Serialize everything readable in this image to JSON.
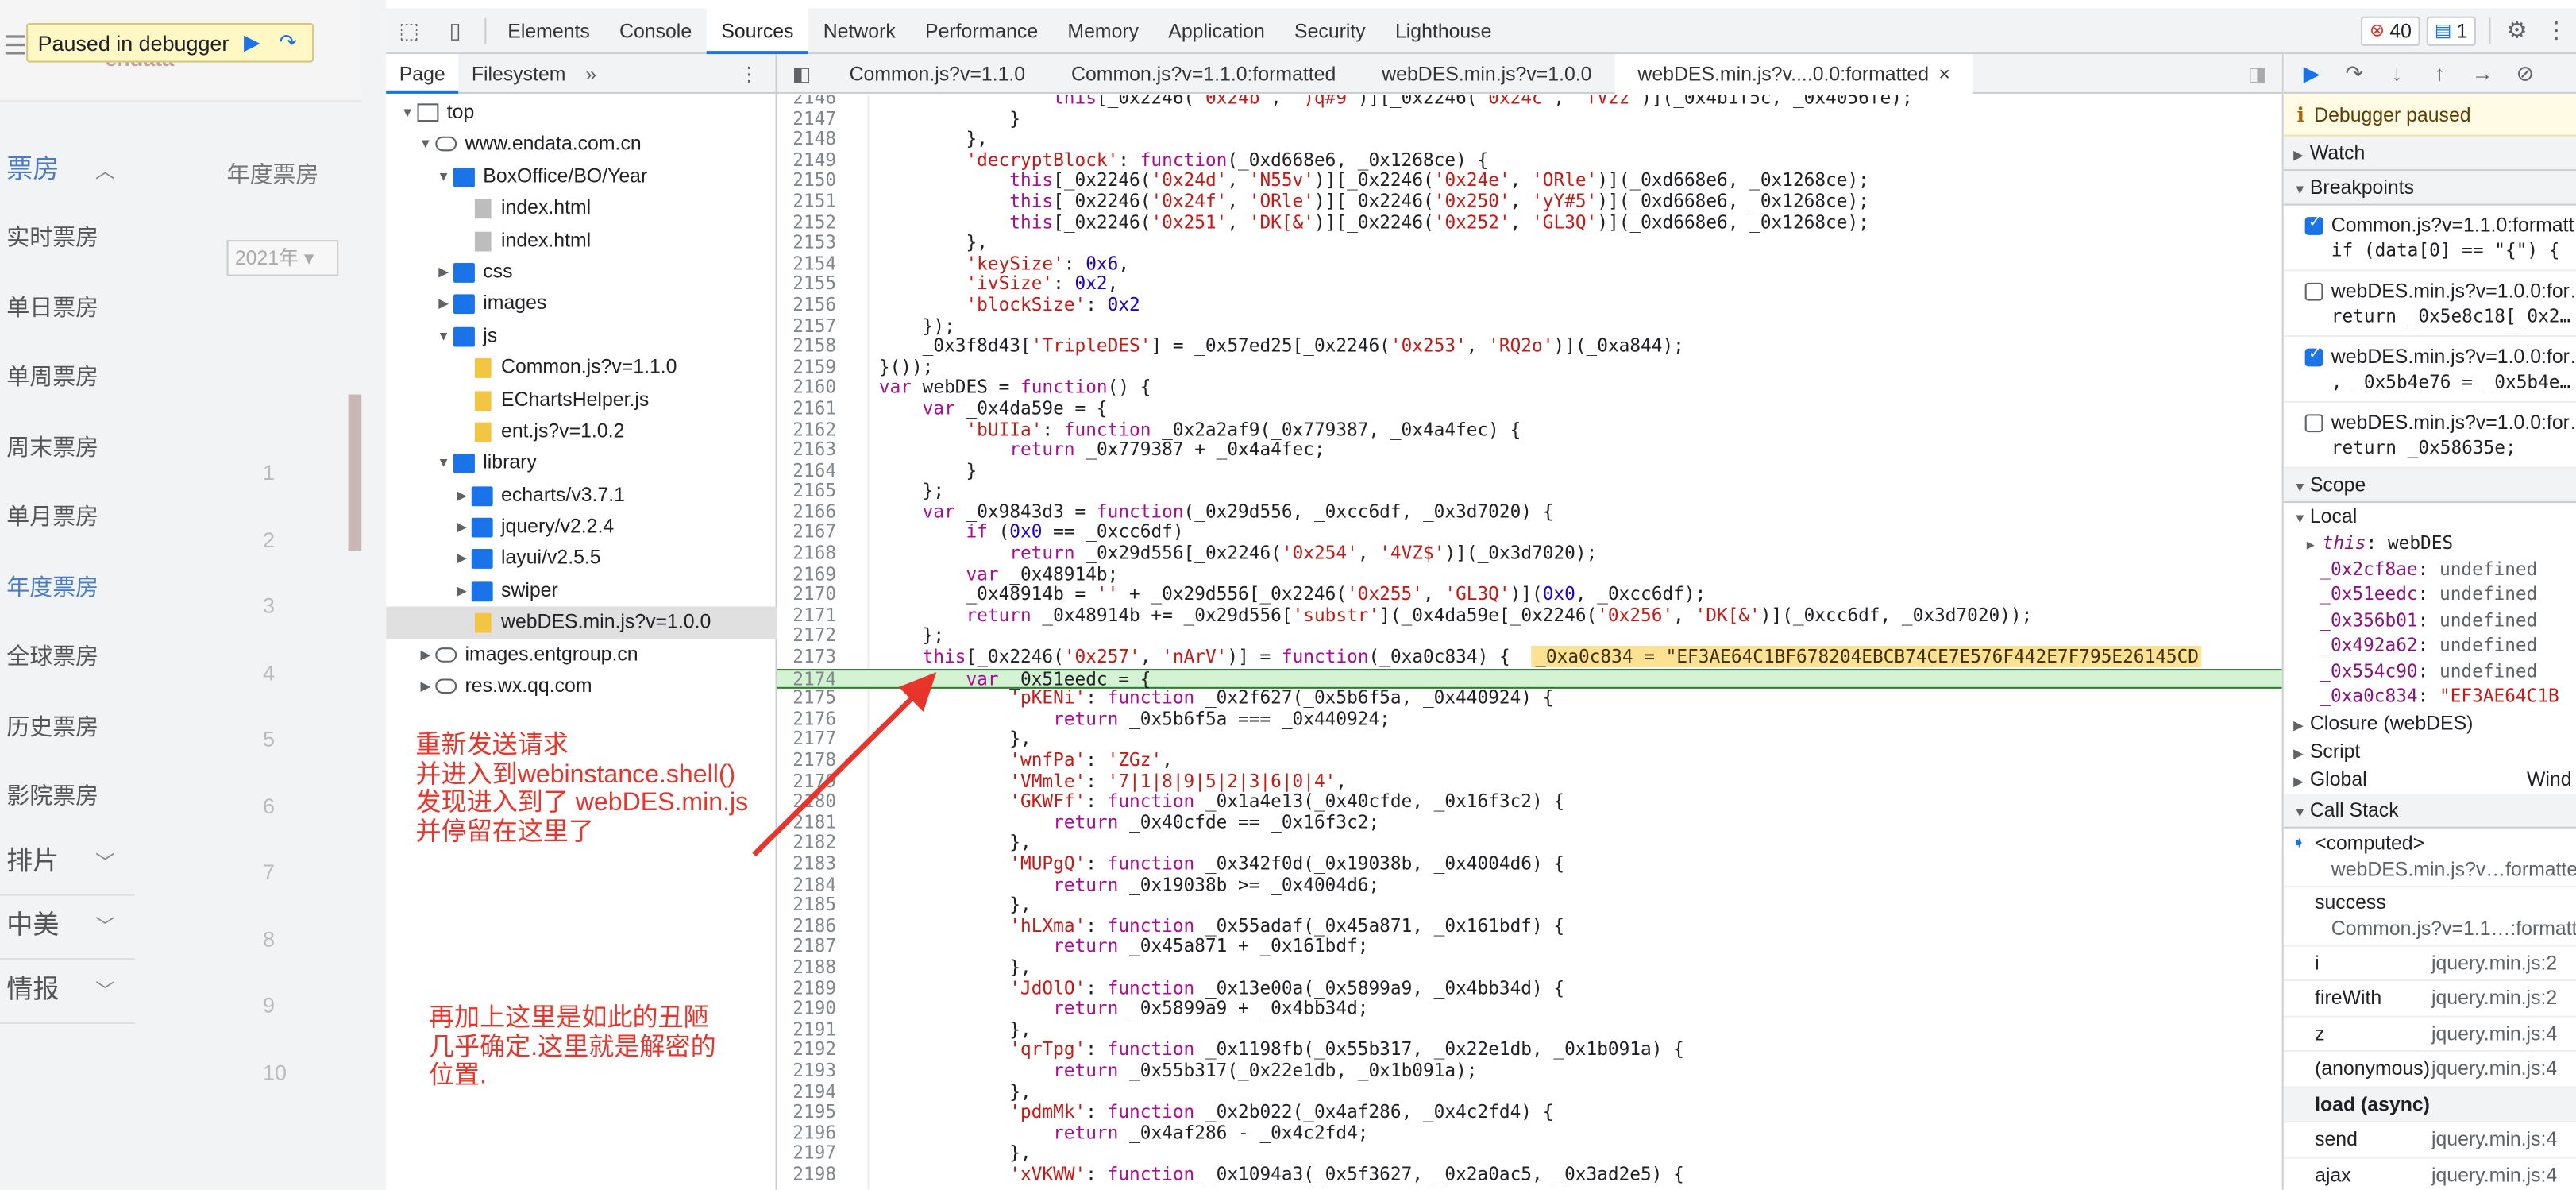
{
  "site": {
    "logo": "endata",
    "paused_label": "Paused in debugger",
    "year_title": "年度票房",
    "year_select": "2021年",
    "nav_head": "票房",
    "nav_items": [
      "实时票房",
      "单日票房",
      "单周票房",
      "周末票房",
      "单月票房",
      "年度票房",
      "全球票房",
      "历史票房",
      "影院票房"
    ],
    "nav_groups": [
      "排片",
      "中美",
      "情报"
    ],
    "ranks": [
      "1",
      "2",
      "3",
      "4",
      "5",
      "6",
      "7",
      "8",
      "9",
      "10"
    ]
  },
  "devtools": {
    "tabs": [
      "Elements",
      "Console",
      "Sources",
      "Network",
      "Performance",
      "Memory",
      "Application",
      "Security",
      "Lighthouse"
    ],
    "active_tab": "Sources",
    "error_count": "40",
    "message_count": "1",
    "navigator_tabs": [
      "Page",
      "Filesystem"
    ],
    "tree": [
      {
        "label": "top",
        "depth": 0,
        "icon": "frame",
        "arrow": "▼"
      },
      {
        "label": "www.endata.com.cn",
        "depth": 1,
        "icon": "cloud",
        "arrow": "▼"
      },
      {
        "label": "BoxOffice/BO/Year",
        "depth": 2,
        "icon": "folder",
        "arrow": "▼"
      },
      {
        "label": "index.html",
        "depth": 3,
        "icon": "file",
        "arrow": ""
      },
      {
        "label": "index.html",
        "depth": 3,
        "icon": "file",
        "arrow": ""
      },
      {
        "label": "css",
        "depth": 2,
        "icon": "folder",
        "arrow": "▶"
      },
      {
        "label": "images",
        "depth": 2,
        "icon": "folder",
        "arrow": "▶"
      },
      {
        "label": "js",
        "depth": 2,
        "icon": "folder",
        "arrow": "▼"
      },
      {
        "label": "Common.js?v=1.1.0",
        "depth": 3,
        "icon": "jsfile",
        "arrow": ""
      },
      {
        "label": "EChartsHelper.js",
        "depth": 3,
        "icon": "jsfile",
        "arrow": ""
      },
      {
        "label": "ent.js?v=1.0.2",
        "depth": 3,
        "icon": "jsfile",
        "arrow": ""
      },
      {
        "label": "library",
        "depth": 2,
        "icon": "folder",
        "arrow": "▼"
      },
      {
        "label": "echarts/v3.7.1",
        "depth": 3,
        "icon": "folder",
        "arrow": "▶"
      },
      {
        "label": "jquery/v2.2.4",
        "depth": 3,
        "icon": "folder",
        "arrow": "▶"
      },
      {
        "label": "layui/v2.5.5",
        "depth": 3,
        "icon": "folder",
        "arrow": "▶"
      },
      {
        "label": "swiper",
        "depth": 3,
        "icon": "folder",
        "arrow": "▶"
      },
      {
        "label": "webDES.min.js?v=1.0.0",
        "depth": 3,
        "icon": "jsfile",
        "arrow": "",
        "selected": true
      },
      {
        "label": "images.entgroup.cn",
        "depth": 1,
        "icon": "cloud",
        "arrow": "▶"
      },
      {
        "label": "res.wx.qq.com",
        "depth": 1,
        "icon": "cloud",
        "arrow": "▶"
      }
    ],
    "annotation1": [
      "重新发送请求",
      "并进入到webinstance.shell()",
      "发现进入到了 webDES.min.js",
      "并停留在这里了"
    ],
    "annotation2": [
      "再加上这里是如此的丑陋",
      "几乎确定.这里就是解密的",
      "位置."
    ],
    "file_tabs": [
      "Common.js?v=1.1.0",
      "Common.js?v=1.1.0:formatted",
      "webDES.min.js?v=1.0.0",
      "webDES.min.js?v....0.0:formatted"
    ],
    "code_lines": [
      {
        "n": "2146",
        "t": "                this[_0x2246('0x24b', ')q#9')][_0x2246('0x24c', 'fVzz')](_0x4b1f5c, _0x4056fe);"
      },
      {
        "n": "2147",
        "t": "            }"
      },
      {
        "n": "2148",
        "t": "        },"
      },
      {
        "n": "2149",
        "t": "        'decryptBlock': function(_0xd668e6, _0x1268ce) {"
      },
      {
        "n": "2150",
        "t": "            this[_0x2246('0x24d', 'N55v')][_0x2246('0x24e', 'ORle')](_0xd668e6, _0x1268ce);"
      },
      {
        "n": "2151",
        "t": "            this[_0x2246('0x24f', 'ORle')][_0x2246('0x250', 'yY#5')](_0xd668e6, _0x1268ce);"
      },
      {
        "n": "2152",
        "t": "            this[_0x2246('0x251', 'DK[&')][_0x2246('0x252', 'GL3Q')](_0xd668e6, _0x1268ce);"
      },
      {
        "n": "2153",
        "t": "        },"
      },
      {
        "n": "2154",
        "t": "        'keySize': 0x6,"
      },
      {
        "n": "2155",
        "t": "        'ivSize': 0x2,"
      },
      {
        "n": "2156",
        "t": "        'blockSize': 0x2"
      },
      {
        "n": "2157",
        "t": "    });"
      },
      {
        "n": "2158",
        "t": "    _0x3f8d43['TripleDES'] = _0x57ed25[_0x2246('0x253', 'RQ2o')](_0xa844);"
      },
      {
        "n": "2159",
        "t": "}());"
      },
      {
        "n": "2160",
        "t": "var webDES = function() {"
      },
      {
        "n": "2161",
        "t": "    var _0x4da59e = {"
      },
      {
        "n": "2162",
        "t": "        'bUIIa': function _0x2a2af9(_0x779387, _0x4a4fec) {"
      },
      {
        "n": "2163",
        "t": "            return _0x779387 + _0x4a4fec;"
      },
      {
        "n": "2164",
        "t": "        }"
      },
      {
        "n": "2165",
        "t": "    };"
      },
      {
        "n": "2166",
        "t": "    var _0x9843d3 = function(_0x29d556, _0xcc6df, _0x3d7020) {"
      },
      {
        "n": "2167",
        "t": "        if (0x0 == _0xcc6df)"
      },
      {
        "n": "2168",
        "t": "            return _0x29d556[_0x2246('0x254', '4VZ$')](_0x3d7020);"
      },
      {
        "n": "2169",
        "t": "        var _0x48914b;"
      },
      {
        "n": "2170",
        "t": "        _0x48914b = '' + _0x29d556[_0x2246('0x255', 'GL3Q')](0x0, _0xcc6df);"
      },
      {
        "n": "2171",
        "t": "        return _0x48914b += _0x29d556['substr'](_0x4da59e[_0x2246('0x256', 'DK[&')](_0xcc6df, _0x3d7020));"
      },
      {
        "n": "2172",
        "t": "    };"
      },
      {
        "n": "2173",
        "t": "    this[_0x2246('0x257', 'nArV')] = function(_0xa0c834) {  _0xa0c834 = \"EF3AE64C1BF678204EBCB74CE7E576F442E7F795E26145CD"
      },
      {
        "n": "2174",
        "t": "        var _0x51eedc = {",
        "exec": true
      },
      {
        "n": "2175",
        "t": "            'pKENi': function _0x2f627(_0x5b6f5a, _0x440924) {"
      },
      {
        "n": "2176",
        "t": "                return _0x5b6f5a === _0x440924;"
      },
      {
        "n": "2177",
        "t": "            },"
      },
      {
        "n": "2178",
        "t": "            'wnfPa': 'ZGz',"
      },
      {
        "n": "2179",
        "t": "            'VMmle': '7|1|8|9|5|2|3|6|0|4',"
      },
      {
        "n": "2180",
        "t": "            'GKWFf': function _0x1a4e13(_0x40cfde, _0x16f3c2) {"
      },
      {
        "n": "2181",
        "t": "                return _0x40cfde == _0x16f3c2;"
      },
      {
        "n": "2182",
        "t": "            },"
      },
      {
        "n": "2183",
        "t": "            'MUPgQ': function _0x342f0d(_0x19038b, _0x4004d6) {"
      },
      {
        "n": "2184",
        "t": "                return _0x19038b >= _0x4004d6;"
      },
      {
        "n": "2185",
        "t": "            },"
      },
      {
        "n": "2186",
        "t": "            'hLXma': function _0x55adaf(_0x45a871, _0x161bdf) {"
      },
      {
        "n": "2187",
        "t": "                return _0x45a871 + _0x161bdf;"
      },
      {
        "n": "2188",
        "t": "            },"
      },
      {
        "n": "2189",
        "t": "            'JdOlO': function _0x13e00a(_0x5899a9, _0x4bb34d) {"
      },
      {
        "n": "2190",
        "t": "                return _0x5899a9 + _0x4bb34d;"
      },
      {
        "n": "2191",
        "t": "            },"
      },
      {
        "n": "2192",
        "t": "            'qrTpg': function _0x1198fb(_0x55b317, _0x22e1db, _0x1b091a) {"
      },
      {
        "n": "2193",
        "t": "                return _0x55b317(_0x22e1db, _0x1b091a);"
      },
      {
        "n": "2194",
        "t": "            },"
      },
      {
        "n": "2195",
        "t": "            'pdmMk': function _0x2b022(_0x4af286, _0x4c2fd4) {"
      },
      {
        "n": "2196",
        "t": "                return _0x4af286 - _0x4c2fd4;"
      },
      {
        "n": "2197",
        "t": "            },"
      },
      {
        "n": "2198",
        "t": "            'xVKWW': function _0x1094a3(_0x5f3627, _0x2a0ac5, _0x3ad2e5) {"
      }
    ],
    "debugger": {
      "paused_label": "Debugger paused",
      "watch_label": "Watch",
      "breakpoints_label": "Breakpoints",
      "breakpoints": [
        {
          "file": "Common.js?v=1.1.0:formatt…",
          "code": "if (data[0] == \"{\") {",
          "checked": true
        },
        {
          "file": "webDES.min.js?v=1.0.0:for…",
          "code": "return _0x5e8c18[_0x2…",
          "checked": false
        },
        {
          "file": "webDES.min.js?v=1.0.0:for…",
          "code": ", _0x5b4e76 = _0x5b4e…",
          "checked": true
        },
        {
          "file": "webDES.min.js?v=1.0.0:for…",
          "code": "return _0x58635e;",
          "checked": false
        }
      ],
      "scope_label": "Scope",
      "local_label": "Local",
      "this_key": "this",
      "this_val": "webDES",
      "locals": [
        {
          "k": "_0x2cf8ae",
          "v": "undefined"
        },
        {
          "k": "_0x51eedc",
          "v": "undefined"
        },
        {
          "k": "_0x356b01",
          "v": "undefined"
        },
        {
          "k": "_0x492a62",
          "v": "undefined"
        },
        {
          "k": "_0x554c90",
          "v": "undefined"
        },
        {
          "k": "_0xa0c834",
          "v": "\"EF3AE64C1B"
        }
      ],
      "closure_label": "Closure (webDES)",
      "script_label": "Script",
      "global_label": "Global",
      "global_val": "Wind",
      "callstack_label": "Call Stack",
      "frames": [
        {
          "fn": "<computed>",
          "loc": "webDES.min.js?v…formatte",
          "current": true,
          "big": true
        },
        {
          "fn": "success",
          "loc": "Common.js?v=1.1…:formatt",
          "big": true
        },
        {
          "fn": "i",
          "loc": "jquery.min.js:2"
        },
        {
          "fn": "fireWith",
          "loc": "jquery.min.js:2"
        },
        {
          "fn": "z",
          "loc": "jquery.min.js:4"
        },
        {
          "fn": "(anonymous)",
          "loc": "jquery.min.js:4"
        },
        {
          "fn": "load (async)",
          "loc": "",
          "async": true
        },
        {
          "fn": "send",
          "loc": "jquery.min.js:4"
        },
        {
          "fn": "ajax",
          "loc": "jquery.min.js:4"
        }
      ]
    }
  }
}
